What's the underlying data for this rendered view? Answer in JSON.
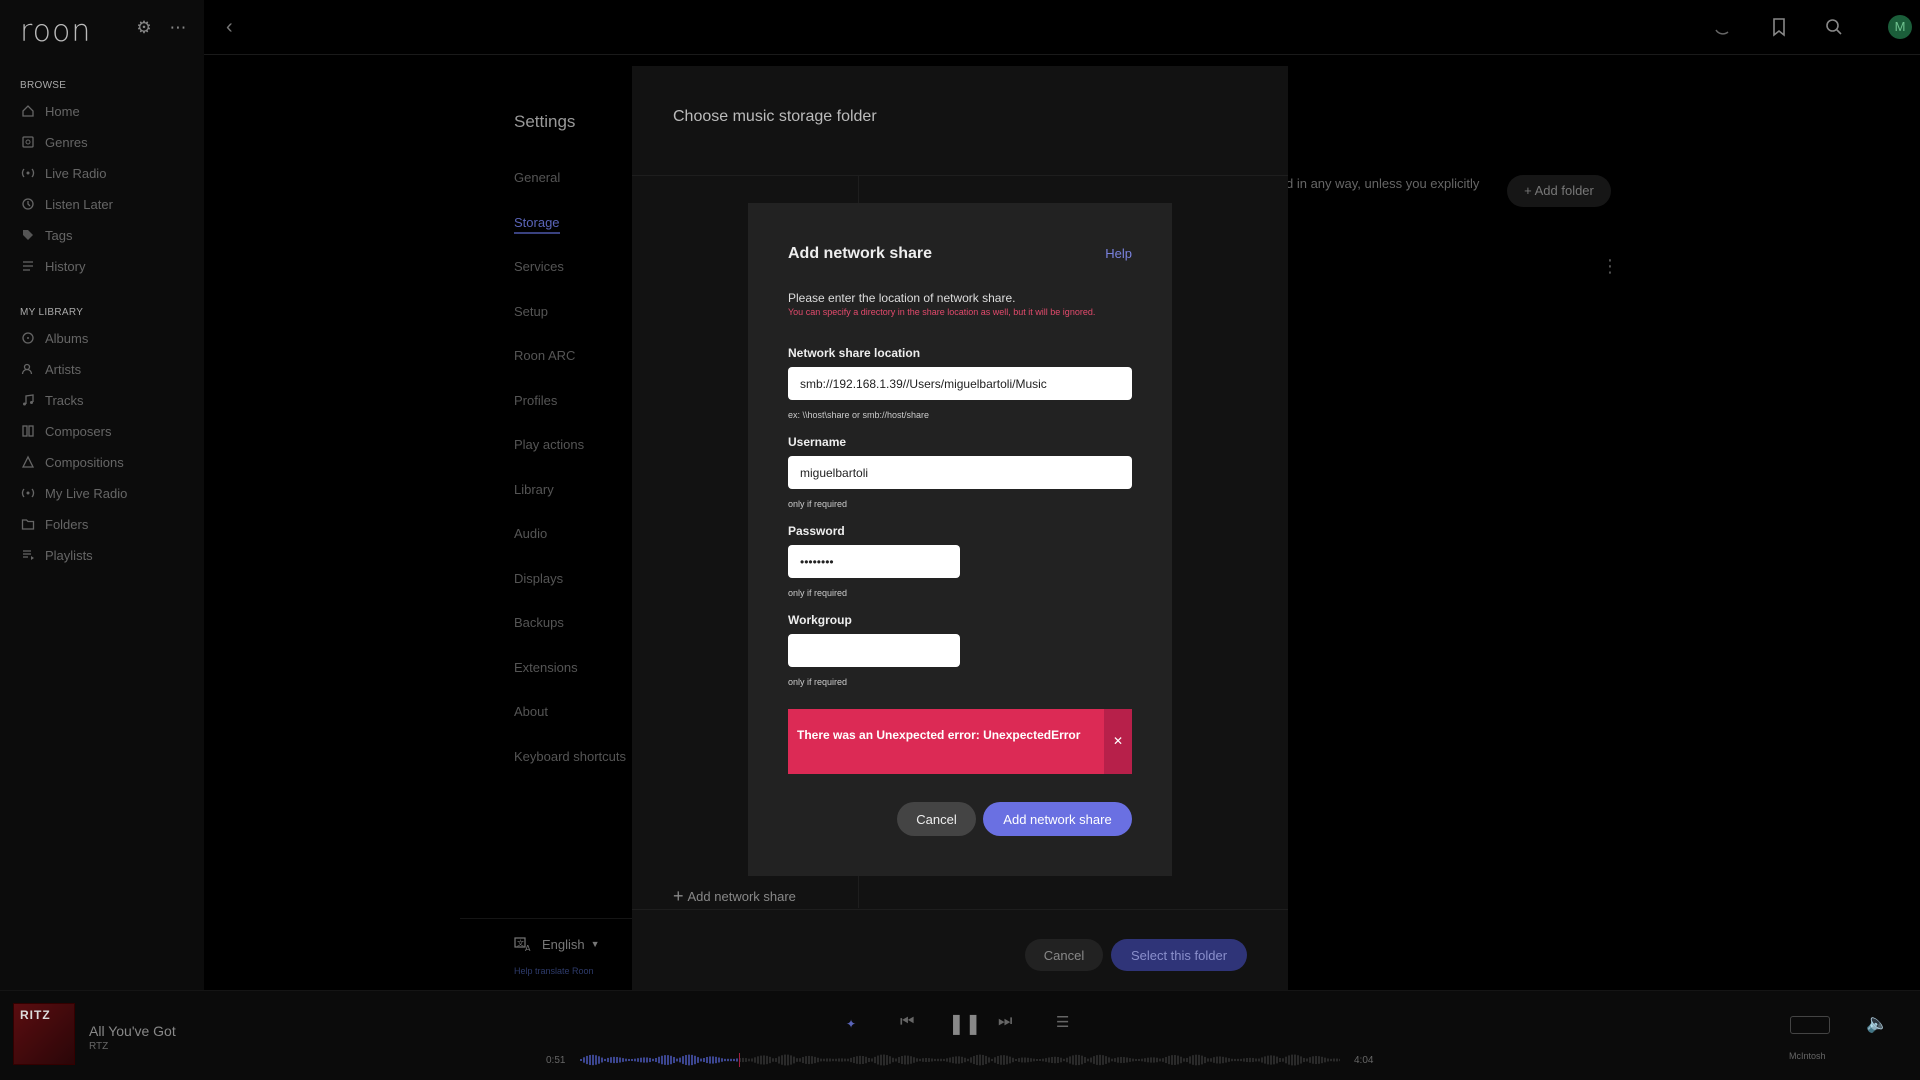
{
  "app": {
    "logo": "roon"
  },
  "sidebar": {
    "browse_title": "BROWSE",
    "browse_items": [
      {
        "label": "Home",
        "icon": "home-icon"
      },
      {
        "label": "Genres",
        "icon": "genres-icon"
      },
      {
        "label": "Live Radio",
        "icon": "radio-icon"
      },
      {
        "label": "Listen Later",
        "icon": "clock-icon"
      },
      {
        "label": "Tags",
        "icon": "tag-icon"
      },
      {
        "label": "History",
        "icon": "history-icon"
      }
    ],
    "library_title": "MY LIBRARY",
    "library_items": [
      {
        "label": "Albums",
        "icon": "album-icon"
      },
      {
        "label": "Artists",
        "icon": "artist-icon"
      },
      {
        "label": "Tracks",
        "icon": "track-icon"
      },
      {
        "label": "Composers",
        "icon": "composer-icon"
      },
      {
        "label": "Compositions",
        "icon": "composition-icon"
      },
      {
        "label": "My Live Radio",
        "icon": "radio-icon"
      },
      {
        "label": "Folders",
        "icon": "folder-icon"
      },
      {
        "label": "Playlists",
        "icon": "playlist-icon"
      }
    ]
  },
  "topbar": {
    "avatar_initial": "M"
  },
  "settings": {
    "title": "Settings",
    "nav": [
      "General",
      "Storage",
      "Services",
      "Setup",
      "Roon ARC",
      "Profiles",
      "Play actions",
      "Library",
      "Audio",
      "Displays",
      "Backups",
      "Extensions",
      "About",
      "Keyboard shortcuts"
    ],
    "active": "Storage",
    "background_text": "d in any way, unless you explicitly",
    "add_folder": "Add folder",
    "language": "English",
    "help_translate": "Help translate Roon"
  },
  "outer_modal": {
    "title": "Choose music storage folder",
    "add_network_share": "Add network share",
    "cancel": "Cancel",
    "select": "Select this folder"
  },
  "dialog": {
    "title": "Add network share",
    "help": "Help",
    "intro": "Please enter the location of network share.",
    "warning": "You can specify a directory in the share location as well, but it will be ignored.",
    "location_label": "Network share location",
    "location_value": "smb://192.168.1.39//Users/miguelbartoli/Music",
    "location_hint": "ex: \\\\host\\share or smb://host/share",
    "username_label": "Username",
    "username_value": "miguelbartoli",
    "username_hint": "only if required",
    "password_label": "Password",
    "password_value": "password",
    "password_hint": "only if required",
    "workgroup_label": "Workgroup",
    "workgroup_value": "",
    "workgroup_hint": "only if required",
    "error": "There was an Unexpected error: UnexpectedError",
    "cancel": "Cancel",
    "submit": "Add network share"
  },
  "player": {
    "album_text": "RITZ",
    "track_title": "All You've Got",
    "artist": "RTZ",
    "elapsed": "0:51",
    "duration": "4:04",
    "device": "McIntosh",
    "progress": 0.209
  }
}
